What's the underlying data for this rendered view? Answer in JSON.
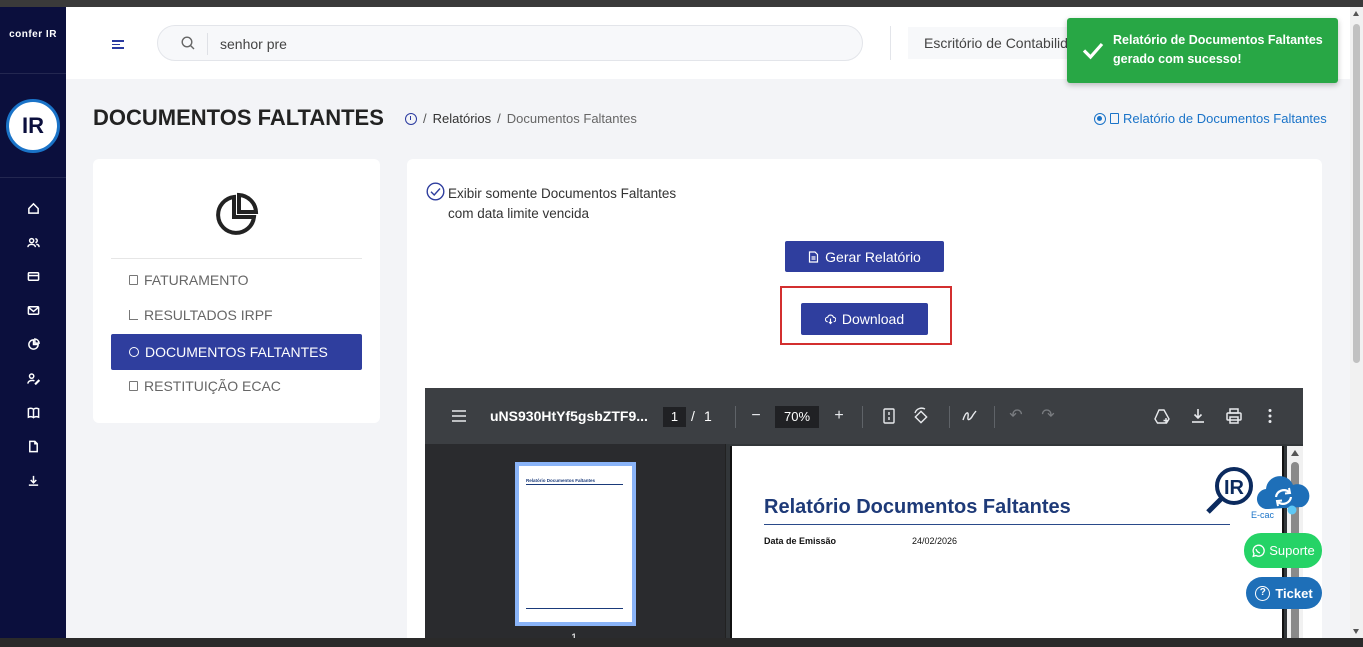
{
  "brand": {
    "name": "confer IR",
    "logo_text": "IR"
  },
  "sidebar_rail": {
    "icons": [
      "home-icon",
      "users-icon",
      "card-icon",
      "mail-icon",
      "pie-chart-icon",
      "user-edit-icon",
      "book-icon",
      "document-icon",
      "download-icon"
    ]
  },
  "header": {
    "search_value": "senhor pre",
    "office": "Escritório de Contabilidade"
  },
  "toast": {
    "message": "Relatório de Documentos Faltantes gerado com sucesso!",
    "color": "#28a745"
  },
  "page": {
    "title": "DOCUMENTOS FALTANTES",
    "breadcrumb": [
      "Relatórios",
      "Documentos Faltantes"
    ],
    "report_link": "Relatório de Documentos Faltantes"
  },
  "side_menu": {
    "items": [
      {
        "label": "FATURAMENTO",
        "icon": "document-icon"
      },
      {
        "label": "RESULTADOS IRPF",
        "icon": "line-chart-icon"
      },
      {
        "label": "DOCUMENTOS FALTANTES",
        "icon": "clock-icon",
        "active": true
      },
      {
        "label": "RESTITUIÇÃO ECAC",
        "icon": "money-icon"
      }
    ]
  },
  "main": {
    "checkbox_label_line1": "Exibir somente Documentos Faltantes",
    "checkbox_label_line2": "com data limite vencida",
    "generate_button": "Gerar Relatório",
    "download_button": "Download"
  },
  "pdf_viewer": {
    "filename": "uNS930HtYf5gsbZTF9...",
    "current_page": "1",
    "page_sep": "/",
    "total_pages": "1",
    "zoom": "70%",
    "thumbnail_number": "1",
    "doc_title": "Relatório Documentos Faltantes",
    "emission_label": "Data de Emissão",
    "emission_date": "24/02/2026",
    "logo_text": "IR",
    "logo_caption": "E-cac"
  },
  "floating": {
    "suporte": "Suporte",
    "ticket": "Ticket"
  },
  "colors": {
    "rail": "#0b0f3d",
    "primary_button": "#2f3e9e",
    "highlight_box": "#d32f2f",
    "whatsapp": "#25d366",
    "ticket": "#1e6fb8"
  }
}
